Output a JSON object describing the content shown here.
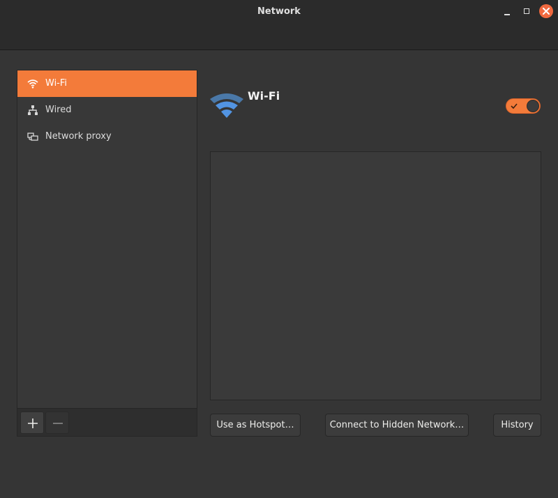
{
  "window": {
    "title": "Network"
  },
  "sidebar": {
    "items": [
      {
        "label": "Wi-Fi",
        "icon": "wifi-icon",
        "active": true
      },
      {
        "label": "Wired",
        "icon": "wired-network-icon",
        "active": false
      },
      {
        "label": "Network proxy",
        "icon": "network-proxy-icon",
        "active": false
      }
    ],
    "add_icon": "plus-icon",
    "remove_icon": "minus-icon"
  },
  "main": {
    "title": "Wi-Fi",
    "toggle_on": true,
    "buttons": {
      "hotspot": "Use as Hotspot…",
      "hidden": "Connect to Hidden Network…",
      "history": "History"
    }
  },
  "colors": {
    "accent": "#f37b3a",
    "close_button": "#f0693f",
    "wifi_icon": "#5294e2"
  }
}
